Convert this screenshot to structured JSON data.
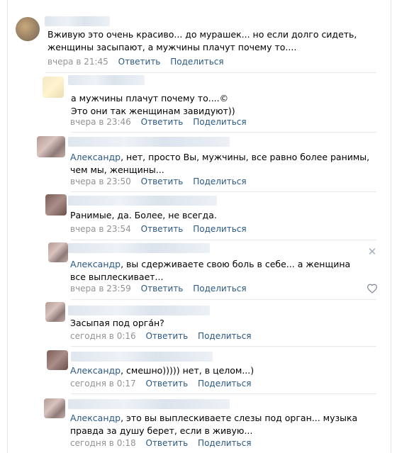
{
  "comments": [
    {
      "text": "Вживую это очень красиво... до мурашек... но если долго сидеть, женщины засыпают, а мужчины плачут почему то....",
      "time": "вчера в 21:45",
      "reply": "Ответить",
      "share": "Поделиться"
    },
    {
      "text": "а мужчины плачут почему то....©\nЭто они так женщинам завидуют))",
      "time": "вчера в 23:46",
      "reply": "Ответить",
      "share": "Поделиться"
    },
    {
      "mention": "Александр",
      "text": ", нет, просто Вы, мужчины, все равно более ранимы, чем мы, женщины...",
      "time": "вчера в 23:50",
      "reply": "Ответить",
      "share": "Поделиться"
    },
    {
      "text": "Ранимые, да. Более, не всегда.",
      "time": "вчера в 23:54",
      "reply": "Ответить",
      "share": "Поделиться"
    },
    {
      "mention": "Александр",
      "text": ", вы сдерживаете свою боль в себе... а женщина все выплескивает...",
      "time": "вчера в 23:59",
      "reply": "Ответить",
      "share": "Поделиться"
    },
    {
      "text": "Засыпая под орга́н?",
      "time": "сегодня в 0:16",
      "reply": "Ответить",
      "share": "Поделиться"
    },
    {
      "mention": "Александр",
      "text": ", смешно))))) нет, в целом...)",
      "time": "сегодня в 0:17",
      "reply": "Ответить",
      "share": "Поделиться"
    },
    {
      "mention": "Александр",
      "text": ", это вы выплескиваете слезы под орган... музыка правда за душу берет, если в живую...",
      "time": "сегодня в 0:18",
      "reply": "Ответить",
      "share": "Поделиться"
    }
  ],
  "icons": {
    "close": "close-icon",
    "like": "heart-icon"
  }
}
